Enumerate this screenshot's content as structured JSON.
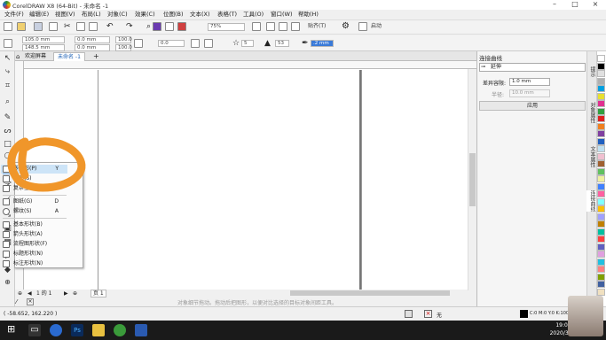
{
  "window": {
    "title": "CorelDRAW X8 (64-Bit) - 未命名 -1"
  },
  "menu": [
    "文件(F)",
    "编辑(E)",
    "视图(V)",
    "布局(L)",
    "对象(C)",
    "效果(C)",
    "位图(B)",
    "文本(X)",
    "表格(T)",
    "工具(O)",
    "窗口(W)",
    "帮助(H)"
  ],
  "toolbar1": {
    "zoom": "75%",
    "snap": "贴齐(T)",
    "launch": "启动"
  },
  "toolbar2": {
    "x": "105.0 mm",
    "y": "148.5 mm",
    "w": "0.0 mm",
    "h": "0.0 mm",
    "sx": "100.0",
    "sy": "100.0",
    "angle": "0.0",
    "points": "5",
    "sharpness": "53",
    "outline": ".2 mm"
  },
  "doc_tabs": {
    "welcome": "欢迎屏幕",
    "doc": "未命名 -1"
  },
  "flyout": [
    {
      "label": "多边形(P)",
      "key": "Y"
    },
    {
      "label": "星形(S)",
      "key": ""
    },
    {
      "label": "复杂星形(C)",
      "key": ""
    },
    {
      "label": "图纸(G)",
      "key": "D"
    },
    {
      "label": "螺纹(S)",
      "key": "A"
    },
    {
      "label": "基本形状(B)",
      "key": ""
    },
    {
      "label": "箭头形状(A)",
      "key": ""
    },
    {
      "label": "流程图形状(F)",
      "key": ""
    },
    {
      "label": "标题形状(N)",
      "key": ""
    },
    {
      "label": "标注形状(N)",
      "key": ""
    }
  ],
  "docker": {
    "title": "连接曲线",
    "mode": "延伸",
    "offset_label": "差异容限:",
    "offset_value": "1.0 mm",
    "radius_label": "半径:",
    "radius_value": "10.0 mm",
    "apply": "应用"
  },
  "docker_tabs": [
    "提示",
    "对象属性",
    "文本属性",
    "连接曲线"
  ],
  "pages": {
    "indicator": "1 的 1",
    "tab": "页 1"
  },
  "hint": "对象细节拖动。拖动后把图形，以便对比选择的目标对象间距工具。",
  "status": {
    "coords": "( -58.652, 162.220 )",
    "fill": "无",
    "outline": "C:0 M:0 Y:0 K:100  .200 mm"
  },
  "taskbar": {
    "time": "19:03",
    "date": "2020/3/26"
  },
  "palette_colors": [
    "#ffffff",
    "#000000",
    "#e0e0e0",
    "#b0b0b0",
    "#00a0e0",
    "#e8e030",
    "#e03090",
    "#30a040",
    "#e02020",
    "#f08020",
    "#8040a0",
    "#2060c0",
    "#c0e0f0",
    "#f0c0d0",
    "#a06030",
    "#60c060",
    "#f0f0a0",
    "#4080ff",
    "#ff60a0",
    "#80ffff",
    "#ffc000",
    "#a0a0ff",
    "#c08000",
    "#00c0a0",
    "#ff4040",
    "#6060c0",
    "#e0a0e0",
    "#20c0e0",
    "#ff8080",
    "#80a000",
    "#4060a0",
    "#f0e0c0"
  ]
}
